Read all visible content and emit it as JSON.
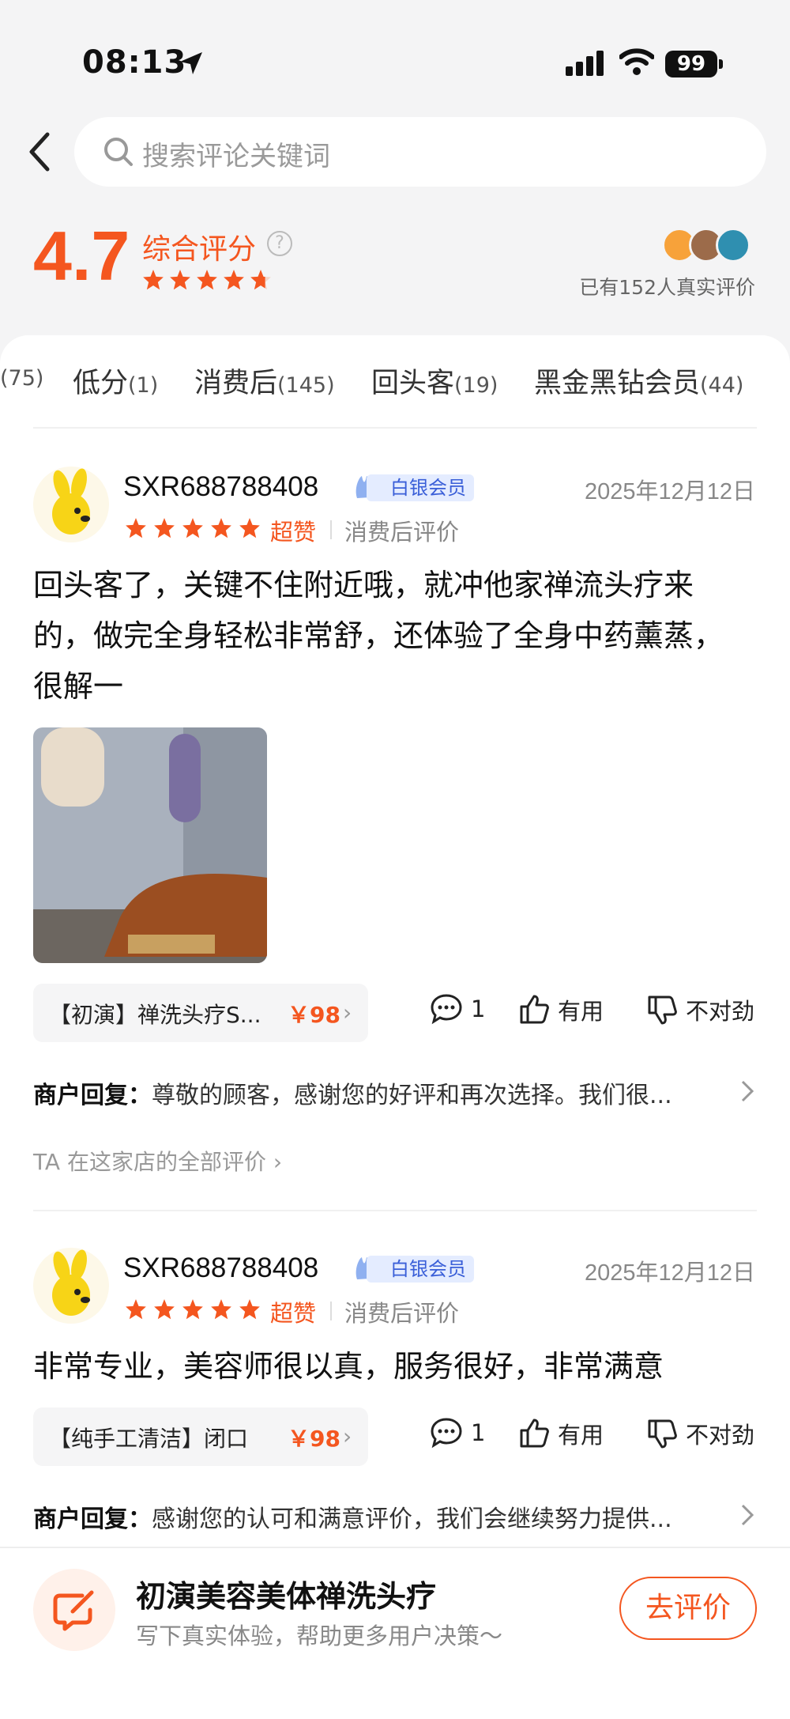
{
  "status_bar": {
    "time": "08:13",
    "battery": "99"
  },
  "search": {
    "placeholder": "搜索评论关键词"
  },
  "rating": {
    "score": "4.7",
    "label": "综合评分",
    "help": "?",
    "stars_value": 4.7,
    "stars_max": 5,
    "count_text": "已有152人真实评价"
  },
  "tabs": [
    {
      "label": "",
      "count": "(75)"
    },
    {
      "label": "低分",
      "count": "(1)"
    },
    {
      "label": "消费后",
      "count": "(145)"
    },
    {
      "label": "回头客",
      "count": "(19)"
    },
    {
      "label": "黑金黑钻会员",
      "count": "(44)"
    }
  ],
  "reviews": [
    {
      "username": "SXR688788408",
      "badge": "白银会员",
      "date": "2025年12月12日",
      "stars": 5,
      "level": "超赞",
      "type": "消费后评价",
      "text_lines": [
        "回头客了，关键不住附近哦，就冲他家禅流头疗来",
        "的，做完全身轻松非常舒，还体验了全身中药薰蒸，",
        "很解一"
      ],
      "product": {
        "name": "【初演】禅洗头疗S...",
        "price": "￥98"
      },
      "comments": "1",
      "useful": "有用",
      "wrong": "不对劲",
      "reply_label": "商户回复：",
      "reply_text": "尊敬的顾客，感谢您的好评和再次选择。我们很...",
      "all_reviews": "TA 在这家店的全部评价"
    },
    {
      "username": "SXR688788408",
      "badge": "白银会员",
      "date": "2025年12月12日",
      "stars": 5,
      "level": "超赞",
      "type": "消费后评价",
      "text_lines": [
        "非常专业，美容师很以真，服务很好，非常满意"
      ],
      "product": {
        "name": "【纯手工清洁】闭口",
        "price": "￥98"
      },
      "comments": "1",
      "useful": "有用",
      "wrong": "不对劲",
      "reply_label": "商户回复：",
      "reply_text": "感谢您的认可和满意评价，我们会继续努力提供..."
    }
  ],
  "bottom": {
    "shop_name": "初演美容美体禅洗头疗",
    "subtitle": "写下真实体验，帮助更多用户决策～",
    "button": "去评价"
  },
  "colors": {
    "accent": "#f4561f",
    "badge_blue": "#3a5fd8",
    "background": "#f4f4f5"
  },
  "icons": [
    "location-arrow-icon",
    "signal-icon",
    "wifi-icon",
    "battery-icon",
    "back-icon",
    "search-icon",
    "help-icon",
    "star-icon",
    "silver-member-icon",
    "comment-icon",
    "thumb-up-icon",
    "thumb-down-icon",
    "chevron-right-icon",
    "write-review-icon"
  ]
}
